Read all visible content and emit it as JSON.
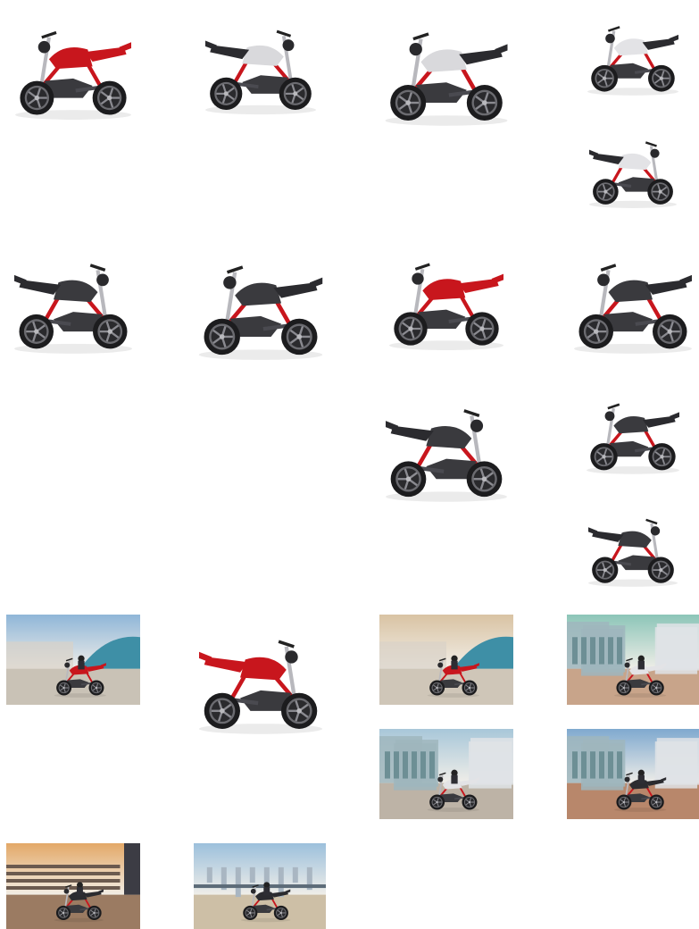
{
  "gallery": {
    "items": [
      {
        "kind": "studio",
        "facing": "left",
        "body": "#c8161d",
        "tank": "#c8161d",
        "frame": "#c8161d"
      },
      {
        "kind": "studio",
        "facing": "right",
        "body": "#2b2b2f",
        "tank": "#d9d9dc",
        "frame": "#c8161d"
      },
      {
        "kind": "studio",
        "facing": "left",
        "body": "#2b2b2f",
        "tank": "#d9d9dc",
        "frame": "#c8161d"
      },
      {
        "kind": "studio",
        "facing": "left",
        "body": "#2b2b2f",
        "tank": "#e3e3e6",
        "frame": "#c8161d"
      },
      {
        "kind": "studio",
        "facing": "right",
        "body": "#2b2b2f",
        "tank": "#e3e3e6",
        "frame": "#c8161d"
      },
      {
        "kind": "studio",
        "facing": "right",
        "body": "#2b2b2f",
        "tank": "#3a3a3e",
        "frame": "#c8161d"
      },
      {
        "kind": "studio",
        "facing": "left",
        "body": "#2b2b2f",
        "tank": "#3a3a3e",
        "frame": "#c8161d"
      },
      {
        "kind": "studio",
        "facing": "left",
        "body": "#c8161d",
        "tank": "#c8161d",
        "frame": "#c8161d"
      },
      {
        "kind": "studio",
        "facing": "left",
        "body": "#2b2b2f",
        "tank": "#3a3a3e",
        "frame": "#c8161d"
      },
      {
        "kind": "studio",
        "facing": "right",
        "body": "#2b2b2f",
        "tank": "#3a3a3e",
        "frame": "#c8161d"
      },
      {
        "kind": "studio",
        "facing": "left",
        "body": "#2b2b2f",
        "tank": "#3a3a3e",
        "frame": "#c8161d"
      },
      {
        "kind": "studio",
        "facing": "right",
        "body": "#2b2b2f",
        "tank": "#3a3a3e",
        "frame": "#c8161d"
      },
      {
        "kind": "scene",
        "scene": "skatepark",
        "sky": "#8fb6d8",
        "ground": "#c9c2b6",
        "bike": "#c8161d"
      },
      {
        "kind": "studio",
        "facing": "right",
        "body": "#c8161d",
        "tank": "#c8161d",
        "frame": "#c8161d"
      },
      {
        "kind": "scene",
        "scene": "skatepark",
        "sky": "#d9c3a3",
        "ground": "#cfc6b8",
        "bike": "#c8161d"
      },
      {
        "kind": "scene",
        "scene": "city-glass",
        "sky": "#8cc5b8",
        "ground": "#c8a48a",
        "bike": "#e3e3e6"
      },
      {
        "kind": "scene",
        "scene": "city-glass",
        "sky": "#a8c7d9",
        "ground": "#bdb3a6",
        "bike": "#e3e3e6"
      },
      {
        "kind": "scene",
        "scene": "city-buildings",
        "sky": "#7fa9cf",
        "ground": "#b8876b",
        "bike": "#2b2b2f"
      },
      {
        "kind": "scene",
        "scene": "stadium",
        "sky": "#e3a867",
        "ground": "#9b7b62",
        "bike": "#2b2b2f"
      },
      {
        "kind": "scene",
        "scene": "bridge",
        "sky": "#9cc0dc",
        "ground": "#cdbfa6",
        "bike": "#2b2b2f"
      }
    ]
  }
}
